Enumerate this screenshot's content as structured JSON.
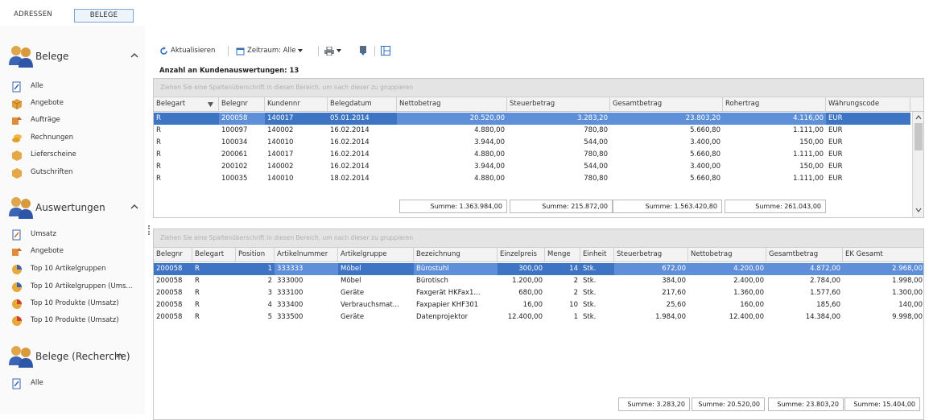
{
  "top_tabs": [
    "ADRESSEN",
    "BELEGE"
  ],
  "sidebar": {
    "groups": [
      {
        "title": "Belege",
        "items": [
          {
            "label": "Alle",
            "icon": "document-edit-icon"
          },
          {
            "label": "Angebote",
            "icon": "box-icon"
          },
          {
            "label": "Aufträge",
            "icon": "order-icon"
          },
          {
            "label": "Rechnungen",
            "icon": "coins-icon"
          },
          {
            "label": "Lieferscheine",
            "icon": "package-icon"
          },
          {
            "label": "Gutschriften",
            "icon": "package-icon"
          }
        ]
      },
      {
        "title": "Auswertungen",
        "items": [
          {
            "label": "Umsatz",
            "icon": "chart-edit-icon"
          },
          {
            "label": "Angebote",
            "icon": "order-icon"
          },
          {
            "label": "Top 10 Artikelgruppen",
            "icon": "pie-chart-icon"
          },
          {
            "label": "Top 10 Artikelgruppen (Ums...",
            "icon": "pie-chart-icon"
          },
          {
            "label": "Top 10 Produkte (Umsatz)",
            "icon": "pie-chart-red-icon"
          },
          {
            "label": "Top 10 Produkte (Umsatz)",
            "icon": "pie-chart-red-icon"
          }
        ]
      },
      {
        "title": "Belege (Recherche)",
        "items": [
          {
            "label": "Alle",
            "icon": "document-edit-icon"
          }
        ]
      }
    ]
  },
  "toolbar": {
    "refresh": "Aktualisieren",
    "period": "Zeitraum: Alle"
  },
  "count_line": "Anzahl an Kundenauswertungen: 13",
  "group_hint": "Ziehen Sie eine Spaltenüberschrift in diesen Bereich, um nach dieser zu gruppieren",
  "table1": {
    "columns": [
      "Belegart",
      "Belegnr",
      "Kundennr",
      "Belegdatum",
      "Nettobetrag",
      "Steuerbetrag",
      "Gesamtbetrag",
      "Rohertrag",
      "Währungscode"
    ],
    "rows": [
      [
        "R",
        "200058",
        "140017",
        "05.01.2014",
        "20.520,00",
        "3.283,20",
        "23.803,20",
        "4.116,00",
        "EUR"
      ],
      [
        "R",
        "100097",
        "140002",
        "16.02.2014",
        "4.880,00",
        "780,80",
        "5.660,80",
        "1.111,00",
        "EUR"
      ],
      [
        "R",
        "100034",
        "140010",
        "16.02.2014",
        "3.944,00",
        "544,00",
        "3.400,00",
        "150,00",
        "EUR"
      ],
      [
        "R",
        "200061",
        "140017",
        "16.02.2014",
        "4.880,00",
        "780,80",
        "5.660,80",
        "1.111,00",
        "EUR"
      ],
      [
        "R",
        "200102",
        "140002",
        "16.02.2014",
        "3.944,00",
        "544,00",
        "3.400,00",
        "150,00",
        "EUR"
      ],
      [
        "R",
        "100035",
        "140010",
        "18.02.2014",
        "4.880,00",
        "780,80",
        "5.660,80",
        "1.111,00",
        "EUR"
      ]
    ],
    "sums": [
      "Summe: 1.363.984,00",
      "Summe: 215.872,00",
      "Summe: 1.563.420,80",
      "Summe: 261.043,00"
    ]
  },
  "table2": {
    "columns": [
      "Belegnr",
      "Belegart",
      "Position",
      "Artikelnummer",
      "Artikelgruppe",
      "Bezeichnung",
      "Einzelpreis",
      "Menge",
      "Einheit",
      "Steuerbetrag",
      "Nettobetrag",
      "Gesamtbetrag",
      "EK Gesamt"
    ],
    "rows": [
      [
        "200058",
        "R",
        "1",
        "333333",
        "Möbel",
        "Bürostuhl",
        "300,00",
        "14",
        "Stk.",
        "672,00",
        "4.200,00",
        "4.872,00",
        "2.968,00"
      ],
      [
        "200058",
        "R",
        "2",
        "333000",
        "Möbel",
        "Bürotisch",
        "1.200,00",
        "2",
        "Stk.",
        "384,00",
        "2.400,00",
        "2.784,00",
        "1.998,00"
      ],
      [
        "200058",
        "R",
        "3",
        "333100",
        "Geräte",
        "Faxgerät HKFax1...",
        "680,00",
        "2",
        "Stk.",
        "217,60",
        "1.360,00",
        "1.577,60",
        "1.300,00"
      ],
      [
        "200058",
        "R",
        "4",
        "333400",
        "Verbrauchsmat...",
        "Faxpapier KHF301",
        "16,00",
        "10",
        "Stk.",
        "25,60",
        "160,00",
        "185,60",
        "140,00"
      ],
      [
        "200058",
        "R",
        "5",
        "333500",
        "Geräte",
        "Datenprojektor",
        "12.400,00",
        "1",
        "Stk.",
        "1.984,00",
        "12.400,00",
        "14.384,00",
        "9.998,00"
      ]
    ],
    "sums": [
      "Summe: 3.283,20",
      "Summe: 20.520,00",
      "Summe: 23.803,20",
      "Summe: 15.404,00"
    ]
  },
  "colors": {
    "selection": "#3d74c4",
    "selection_cell": "#5e8fd8",
    "tab_border": "#7aa6d6",
    "header_bg": "#f3f3f3",
    "group_area_bg": "#e4e4e4"
  }
}
